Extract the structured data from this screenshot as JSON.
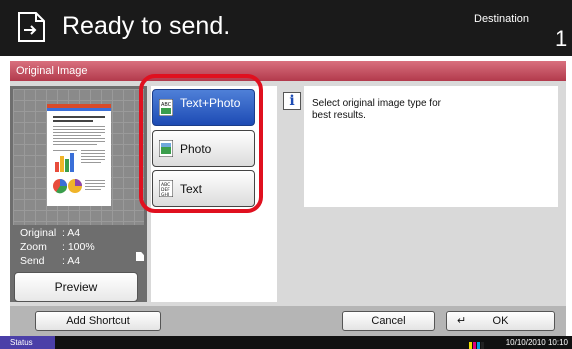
{
  "header": {
    "title": "Ready to send.",
    "destination_label": "Destination",
    "destination_count": "1"
  },
  "panel": {
    "title": "Original Image"
  },
  "preview": {
    "rows": [
      {
        "key": "Original",
        "value": ": A4"
      },
      {
        "key": "Zoom",
        "value": ": 100%"
      },
      {
        "key": "Send",
        "value": ": A4"
      }
    ],
    "button_label": "Preview"
  },
  "image_types": [
    {
      "label": "Text+Photo",
      "icon": "text-photo-icon",
      "selected": true
    },
    {
      "label": "Photo",
      "icon": "photo-icon",
      "selected": false
    },
    {
      "label": "Text",
      "icon": "text-icon",
      "selected": false
    }
  ],
  "info": {
    "text": "Select original image type for best results."
  },
  "bottom": {
    "add_shortcut": "Add Shortcut",
    "cancel": "Cancel",
    "ok": "OK"
  },
  "status": {
    "label": "Status",
    "datetime": "10/10/2010  10:10"
  },
  "colors": {
    "selected_button": "#1d4bb4",
    "highlight_ring": "#e0101f",
    "title_bar": "#b23a4c",
    "status_label": "#4b3fa8"
  }
}
